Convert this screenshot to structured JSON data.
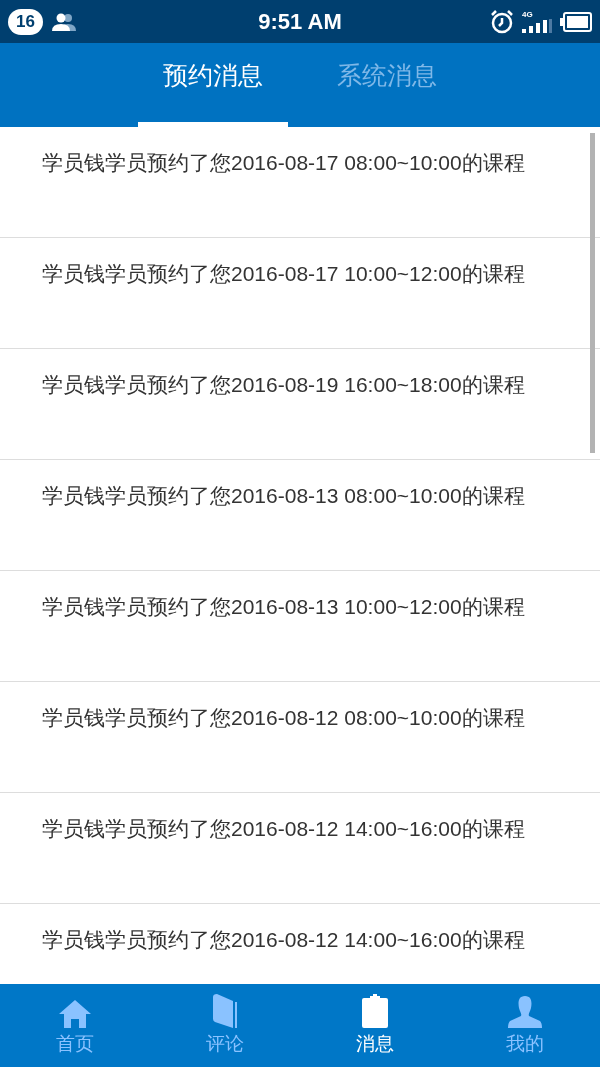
{
  "status_bar": {
    "notification_count": "16",
    "time": "9:51 AM",
    "network": "4G"
  },
  "tabs": [
    {
      "label": "预约消息",
      "selected": true
    },
    {
      "label": "系统消息",
      "selected": false
    }
  ],
  "messages": [
    {
      "text": "学员钱学员预约了您2016-08-17 08:00~10:00的课程"
    },
    {
      "text": "学员钱学员预约了您2016-08-17 10:00~12:00的课程"
    },
    {
      "text": "学员钱学员预约了您2016-08-19 16:00~18:00的课程"
    },
    {
      "text": "学员钱学员预约了您2016-08-13 08:00~10:00的课程"
    },
    {
      "text": "学员钱学员预约了您2016-08-13 10:00~12:00的课程"
    },
    {
      "text": "学员钱学员预约了您2016-08-12 08:00~10:00的课程"
    },
    {
      "text": "学员钱学员预约了您2016-08-12 14:00~16:00的课程"
    },
    {
      "text": "学员钱学员预约了您2016-08-12 14:00~16:00的课程"
    }
  ],
  "bottom_nav": [
    {
      "label": "首页",
      "kind": "home",
      "selected": false
    },
    {
      "label": "评论",
      "kind": "book",
      "selected": false
    },
    {
      "label": "消息",
      "kind": "clipboard",
      "selected": true
    },
    {
      "label": "我的",
      "kind": "person",
      "selected": false
    }
  ]
}
